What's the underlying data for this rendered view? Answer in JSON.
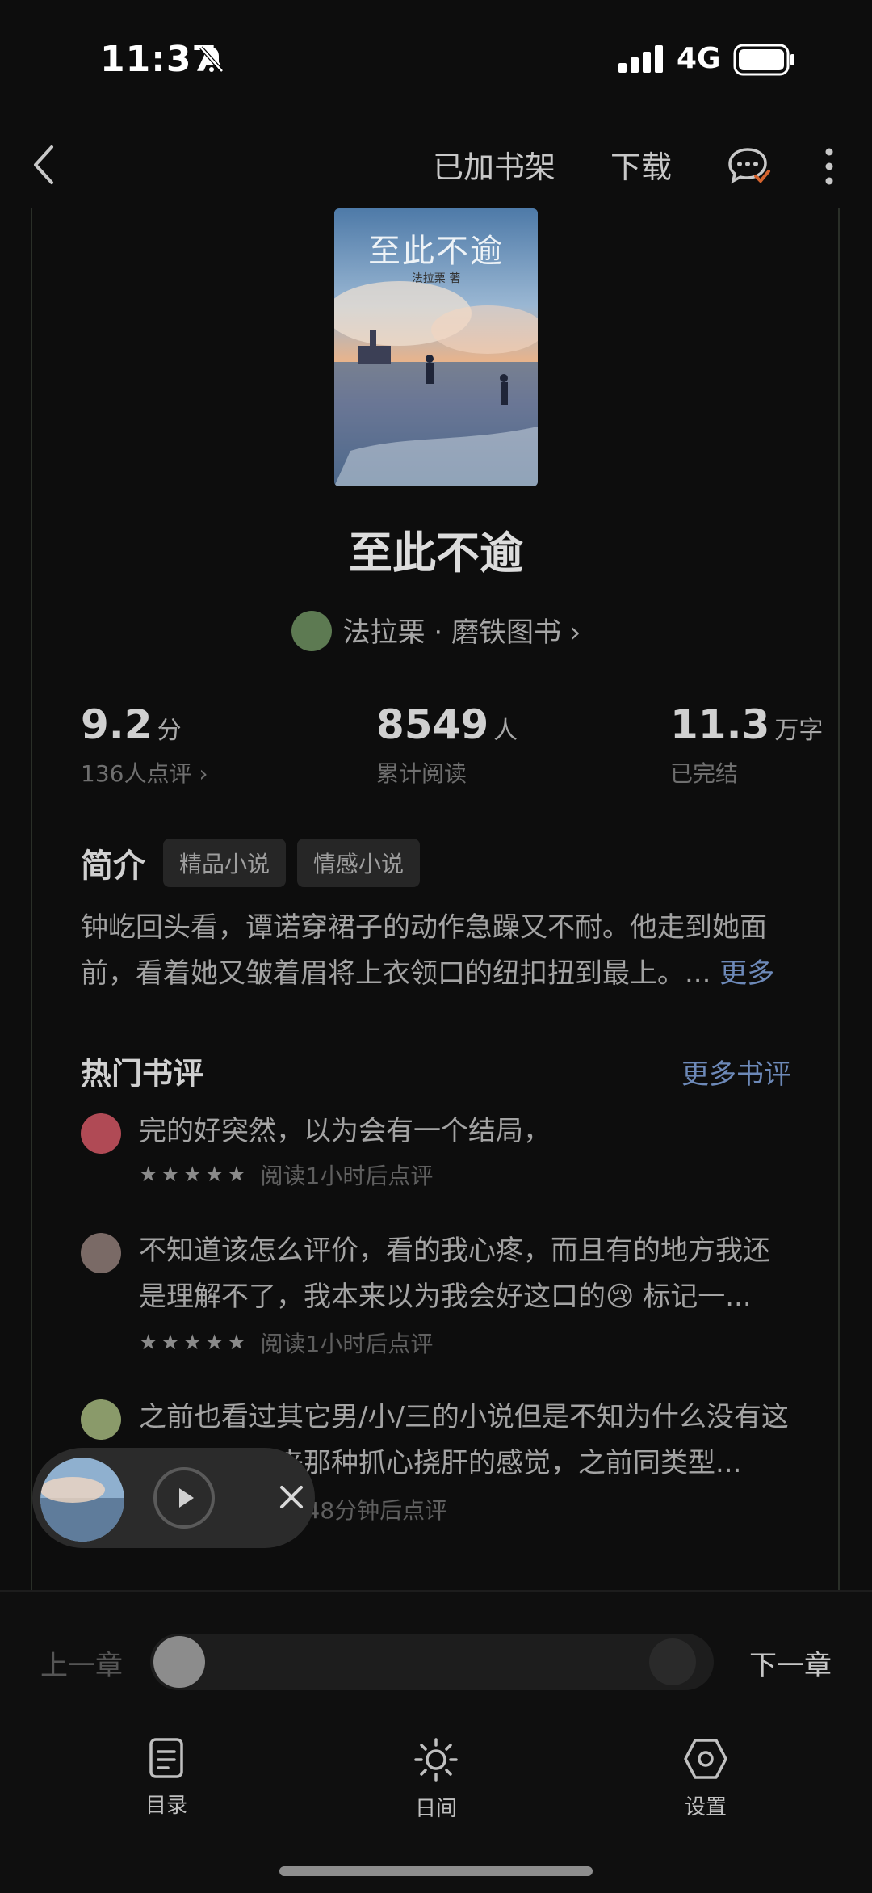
{
  "status_bar": {
    "time": "11:37",
    "network": "4G"
  },
  "topbar": {
    "shelf_label": "已加书架",
    "download_label": "下载"
  },
  "book": {
    "cover_title": "至此不逾",
    "cover_author": "法拉栗 著",
    "title": "至此不逾",
    "author_line": "法拉栗 · 磨铁图书 ›"
  },
  "stats": {
    "score": "9.2",
    "score_unit": "分",
    "score_sub": "136人点评 ›",
    "readers": "8549",
    "readers_unit": "人",
    "readers_sub": "累计阅读",
    "words": "11.3",
    "words_unit": "万字",
    "words_sub": "已完结"
  },
  "intro": {
    "heading": "简介",
    "tags": [
      "精品小说",
      "情感小说"
    ],
    "line1": "钟屹回头看，谭诺穿裙子的动作急躁又不耐。他走到她面",
    "line2": "前，看着她又皱着眉将上衣领口的纽扣扭到最上。... ",
    "more": "更多"
  },
  "reviews": {
    "heading": "热门书评",
    "more": "更多书评",
    "items": [
      {
        "text": "完的好突然，以为会有一个结局，",
        "stars": "★★★★★",
        "meta": "阅读1小时后点评",
        "avatar_color": "#b04a55"
      },
      {
        "text": "不知道该怎么评价，看的我心疼，而且有的地方我还是理解不了，我本来以为我会好这口的😢 标记一...",
        "stars": "★★★★★",
        "meta": "阅读1小时后点评",
        "avatar_color": "#7a6a66"
      },
      {
        "text": "之前也看过其它男/小/三的小说但是不知为什么没有这本书给我带来那种抓心挠肝的感觉，之前同类型...",
        "stars": "★★★★★",
        "meta": "阅读48分钟后点评",
        "avatar_color": "#8a9a6a"
      }
    ]
  },
  "chapter_nav": {
    "prev": "上一章",
    "next": "下一章",
    "progress": 0
  },
  "bottom_tabs": {
    "toc": "目录",
    "day": "日间",
    "settings": "设置"
  }
}
